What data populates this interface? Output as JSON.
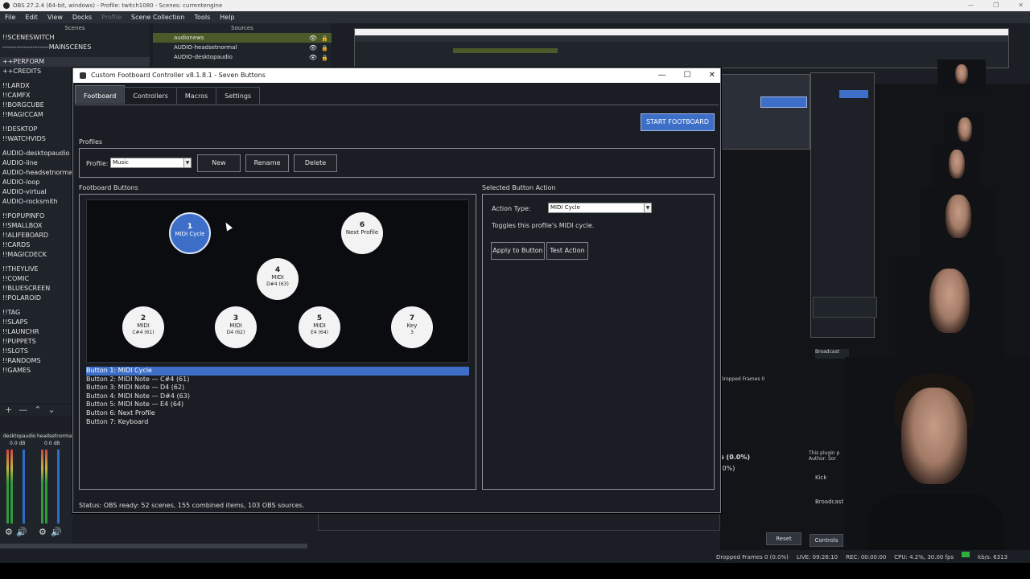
{
  "obs": {
    "title": "OBS 27.2.4 (64-bit, windows) - Profile: twitch1080 - Scenes: currentengine",
    "menu": [
      "File",
      "Edit",
      "View",
      "Docks",
      "Profile",
      "Scene Collection",
      "Tools",
      "Help"
    ],
    "scenes_header": "Scenes",
    "sources_header": "Sources",
    "scenes": [
      {
        "label": "!!SCENESWITCH"
      },
      {
        "label": "--------------------MAINSCENES"
      },
      {
        "gap": true
      },
      {
        "label": "++PERFORM",
        "sel": true
      },
      {
        "label": "++CREDITS"
      },
      {
        "gap": true
      },
      {
        "label": "!!LARDX"
      },
      {
        "label": "!!CAMFX"
      },
      {
        "label": "!!BORGCUBE"
      },
      {
        "label": "!!MAGICCAM"
      },
      {
        "gap": true
      },
      {
        "label": "!!DESKTOP"
      },
      {
        "label": "!!WATCHVIDS"
      },
      {
        "gap": true
      },
      {
        "label": "AUDIO-desktopaudio"
      },
      {
        "label": "AUDIO-line"
      },
      {
        "label": "AUDIO-headsetnormal"
      },
      {
        "label": "AUDIO-loop"
      },
      {
        "label": "AUDIO-virtual"
      },
      {
        "label": "AUDIO-rocksmith"
      },
      {
        "gap": true
      },
      {
        "label": "!!POPUPINFO"
      },
      {
        "label": "!!SMALLBOX"
      },
      {
        "label": "!!ALIFEBOARD"
      },
      {
        "label": "!!CARDS"
      },
      {
        "label": "!!MAGICDECK"
      },
      {
        "gap": true
      },
      {
        "label": "!!THEYLIVE"
      },
      {
        "label": "!!COMIC"
      },
      {
        "label": "!!BLUESCREEN"
      },
      {
        "label": "!!POLAROID"
      },
      {
        "gap": true
      },
      {
        "label": "!!TAG"
      },
      {
        "label": "!!SLAPS"
      },
      {
        "label": "!!LAUNCHR"
      },
      {
        "label": "!!PUPPETS"
      },
      {
        "label": "!!SLOTS"
      },
      {
        "label": "!!RANDOMS"
      },
      {
        "label": "!!GAMES"
      }
    ],
    "sources": [
      {
        "label": "audionews",
        "sel": true
      },
      {
        "label": "AUDIO-headsetnormal"
      },
      {
        "label": "AUDIO-desktopaudio"
      }
    ],
    "mixer": [
      {
        "name": "desktopaudio",
        "db": "0.0 dB"
      },
      {
        "name": "headsetnormal",
        "db": "0.0 dB"
      }
    ],
    "status_dropped": "Dropped Frames 0 (0.0%)",
    "status_live": "LIVE: 09:26:10",
    "status_rec": "REC: 00:00:00",
    "status_cpu": "CPU: 4.2%, 30.00 fps",
    "status_kbs": "kb/s: 6313",
    "controls_label": "Controls",
    "reset_label": "Reset"
  },
  "dialog": {
    "title": "Custom Footboard Controller v8.1.8.1 - Seven Buttons",
    "tabs": [
      "Footboard",
      "Controllers",
      "Macros",
      "Settings"
    ],
    "start_button": "START FOOTBOARD",
    "profiles_group": "Profiles",
    "profile_label": "Profile:",
    "profile_value": "Music",
    "new_button": "New",
    "rename_button": "Rename",
    "delete_button": "Delete",
    "footboard_group": "Footboard Buttons",
    "buttons": [
      {
        "n": "1",
        "a": "MIDI Cycle",
        "b": "",
        "sel": true
      },
      {
        "n": "6",
        "a": "Next Profile",
        "b": ""
      },
      {
        "n": "4",
        "a": "MIDI",
        "b": "D#4 (63)"
      },
      {
        "n": "2",
        "a": "MIDI",
        "b": "C#4 (61)"
      },
      {
        "n": "3",
        "a": "MIDI",
        "b": "D4 (62)"
      },
      {
        "n": "5",
        "a": "MIDI",
        "b": "E4 (64)"
      },
      {
        "n": "7",
        "a": "Key",
        "b": "3"
      }
    ],
    "button_list": [
      "Button 1: MIDI Cycle",
      "Button 2: MIDI Note — C#4 (61)",
      "Button 3: MIDI Note — D4 (62)",
      "Button 4: MIDI Note — D#4 (63)",
      "Button 5: MIDI Note — E4 (64)",
      "Button 6: Next Profile",
      "Button 7: Keyboard"
    ],
    "action_group": "Selected Button Action",
    "action_type_label": "Action Type:",
    "action_type_value": "MIDI Cycle",
    "action_desc": "Toggles this profile's MIDI cycle.",
    "apply_button": "Apply to Button",
    "test_button": "Test Action",
    "status": "Status:   OBS ready: 52 scenes, 155 combined items, 103 OBS sources."
  }
}
